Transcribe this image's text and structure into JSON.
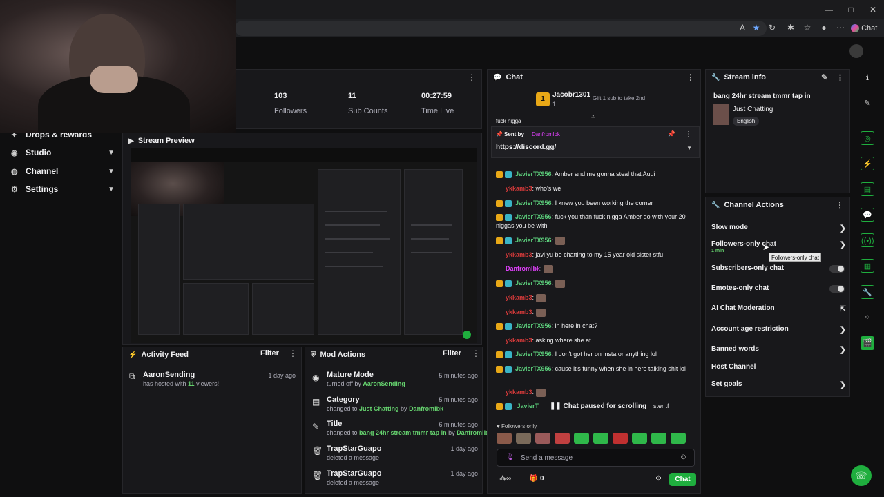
{
  "browser": {
    "chat_label": "Chat",
    "window_controls": [
      "—",
      "□",
      "✕"
    ]
  },
  "stats": [
    {
      "value": "103",
      "label": "Followers"
    },
    {
      "value": "11",
      "label": "Sub Counts"
    },
    {
      "value": "00:27:59",
      "label": "Time Live"
    }
  ],
  "sidebar": {
    "items": [
      {
        "label": "Drops & rewards",
        "icon": "gift-icon"
      },
      {
        "label": "Studio",
        "icon": "studio-icon"
      },
      {
        "label": "Channel",
        "icon": "channel-icon"
      },
      {
        "label": "Settings",
        "icon": "gear-icon"
      }
    ]
  },
  "preview": {
    "title": "Stream Preview"
  },
  "activity": {
    "title": "Activity Feed",
    "filter": "Filter",
    "items": [
      {
        "user": "AaronSending",
        "pre": "has hosted with ",
        "count": "11",
        "post": " viewers!",
        "time": "1 day ago"
      }
    ]
  },
  "mod": {
    "title": "Mod Actions",
    "filter": "Filter",
    "items": [
      {
        "title": "Mature Mode",
        "pre": "turned off by ",
        "hl": "AaronSending",
        "mid": "",
        "hl2": "",
        "time": "5 minutes ago"
      },
      {
        "title": "Category",
        "pre": "changed to ",
        "hl": "Just Chatting",
        "mid": " by ",
        "hl2": "Danfromlbk",
        "time": "5 minutes ago"
      },
      {
        "title": "Title",
        "pre": "changed to ",
        "hl": "bang 24hr stream tmmr tap in",
        "mid": " by ",
        "hl2": "Danfromlbk",
        "time": "6 minutes ago"
      },
      {
        "title": "TrapStarGuapo",
        "pre": "deleted a message",
        "hl": "",
        "mid": "",
        "hl2": "",
        "time": "1 day ago"
      },
      {
        "title": "TrapStarGuapo",
        "pre": "deleted a message",
        "hl": "",
        "mid": "",
        "hl2": "",
        "time": "1 day ago"
      }
    ]
  },
  "chat": {
    "title": "Chat",
    "gifter": {
      "name": "Jacobr1301",
      "count": "1",
      "gift_text": "Gift 1 sub to take 2nd"
    },
    "pinned": {
      "sent_by": "Sent by",
      "sender": "Danfromlbk",
      "link": "https://discord.gg/"
    },
    "overflow_text": "fuck nigga",
    "messages": [
      {
        "user": "JavierTX956",
        "cls": "u-jav",
        "text": "Amber and me gonna steal that Audi",
        "emote": false
      },
      {
        "user": "ykkamb3",
        "cls": "u-ykk",
        "text": "who's we",
        "emote": false
      },
      {
        "user": "JavierTX956",
        "cls": "u-jav",
        "text": "I knew you been working the corner",
        "emote": false
      },
      {
        "user": "JavierTX956",
        "cls": "u-jav",
        "text": "fuck you than fuck nigga Amber go with your 20 niggas you be with",
        "emote": false
      },
      {
        "user": "JavierTX956",
        "cls": "u-jav",
        "text": "",
        "emote": true
      },
      {
        "user": "ykkamb3",
        "cls": "u-ykk",
        "text": "javi yu be chatting to my 15 year old sister stfu",
        "emote": false
      },
      {
        "user": "Danfromlbk",
        "cls": "u-dan",
        "text": "",
        "emote": true
      },
      {
        "user": "JavierTX956",
        "cls": "u-jav",
        "text": "",
        "emote": true
      },
      {
        "user": "ykkamb3",
        "cls": "u-ykk",
        "text": "",
        "emote": true
      },
      {
        "user": "ykkamb3",
        "cls": "u-ykk",
        "text": "",
        "emote": true
      },
      {
        "user": "JavierTX956",
        "cls": "u-jav",
        "text": "in here in chat?",
        "emote": false
      },
      {
        "user": "ykkamb3",
        "cls": "u-ykk",
        "text": "asking where she at",
        "emote": false
      },
      {
        "user": "JavierTX956",
        "cls": "u-jav",
        "text": "I don't got her on insta or anything lol",
        "emote": false
      },
      {
        "user": "JavierTX956",
        "cls": "u-jav",
        "text": "cause it's funny when she in here talking shit lol",
        "emote": false
      },
      {
        "user": "ykkamb3",
        "cls": "u-ykk",
        "text": "",
        "emote": true
      }
    ],
    "partial_user": "JavierT",
    "partial_tail": "r sister tf",
    "paused": "Chat paused for scrolling",
    "followers_only": "Followers only",
    "input_placeholder": "Send a message",
    "points": "0",
    "send_label": "Chat"
  },
  "stream_info": {
    "header": "Stream info",
    "title": "bang 24hr stream tmmr tap in",
    "category": "Just Chatting",
    "tag": "English"
  },
  "channel_actions": {
    "header": "Channel Actions",
    "items": [
      {
        "label": "Slow mode",
        "kind": "chev",
        "sub": ""
      },
      {
        "label": "Followers-only chat",
        "kind": "chev",
        "sub": "1 min"
      },
      {
        "label": "Subscribers-only chat",
        "kind": "toggle",
        "sub": ""
      },
      {
        "label": "Emotes-only chat",
        "kind": "toggle",
        "sub": ""
      },
      {
        "label": "AI Chat Moderation",
        "kind": "ext",
        "sub": ""
      },
      {
        "label": "Account age restriction",
        "kind": "chev",
        "sub": ""
      },
      {
        "label": "Banned words",
        "kind": "chev",
        "sub": ""
      },
      {
        "label": "Host Channel",
        "kind": "none",
        "sub": ""
      },
      {
        "label": "Set goals",
        "kind": "chev",
        "sub": ""
      }
    ],
    "tooltip": "Followers-only chat"
  },
  "colors": {
    "accent": "#1fae3e",
    "panel": "#18181b",
    "bg": "#0f0f10"
  }
}
